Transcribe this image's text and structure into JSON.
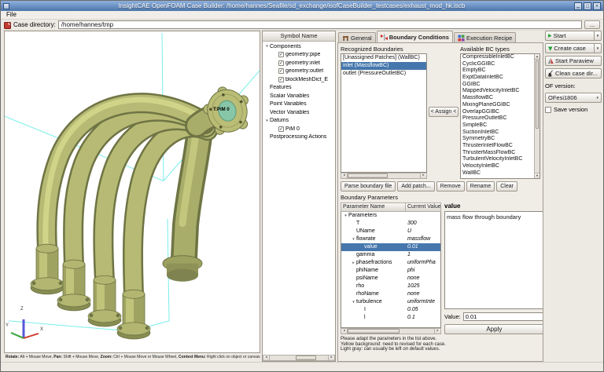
{
  "window": {
    "title": "InsightCAE OpenFOAM Case Builder: /home/hannes/Seafile/sd_exchange/isofCaseBuilder_testcases/exhaust_mod_hk.iscb",
    "menu": [
      "File"
    ]
  },
  "toolbar": {
    "case_directory_label": "Case directory:",
    "case_directory_value": "/home/hannes/tmp",
    "browse_label": "..."
  },
  "viewport": {
    "datum_label": "T:PiM 0",
    "axes": [
      "X",
      "Y",
      "Z"
    ],
    "hint_parts": [
      {
        "key": "Rotate:",
        "text": " Alt + Mouse Move, "
      },
      {
        "key": "Pan:",
        "text": " Shift + Mouse Move, "
      },
      {
        "key": "Zoom:",
        "text": " Ctrl + Mouse Move or Mouse Wheel, "
      },
      {
        "key": "Context Menu:",
        "text": " Right click on object or canvas."
      }
    ]
  },
  "symbol_tree": {
    "header": "Symbol Name",
    "items": [
      {
        "label": "Components",
        "depth": 0,
        "expander": "open"
      },
      {
        "label": "geometry:pipe",
        "depth": 1,
        "checked": true
      },
      {
        "label": "geometry:inlet",
        "depth": 1,
        "checked": true
      },
      {
        "label": "geometry:outlet",
        "depth": 1,
        "checked": true
      },
      {
        "label": "blockMeshDict_E",
        "depth": 1,
        "checked": true
      },
      {
        "label": "Features",
        "depth": 0
      },
      {
        "label": "Scalar Variables",
        "depth": 0
      },
      {
        "label": "Point Variables",
        "depth": 0
      },
      {
        "label": "Vector Variables",
        "depth": 0
      },
      {
        "label": "Datums",
        "depth": 0,
        "expander": "open"
      },
      {
        "label": "PiM 0",
        "depth": 1,
        "checked": true
      },
      {
        "label": "Postprocessing Actions",
        "depth": 0
      }
    ]
  },
  "tabs": [
    {
      "label": "General"
    },
    {
      "label": "Boundary Conditions",
      "active": true
    },
    {
      "label": "Execution Recipe"
    }
  ],
  "boundary_conditions": {
    "recognized_label": "Recognized Boundaries",
    "recognized": [
      {
        "label": "[Unassigned Patches] (WallBC)"
      },
      {
        "label": "inlet (MassflowBC)",
        "selected": true
      },
      {
        "label": "outlet (PressureOutletBC)"
      }
    ],
    "assign_label": "< Assign <",
    "available_label": "Available BC types",
    "available": [
      "CompressibleInletBC",
      "CyclicGGIBC",
      "EmptyBC",
      "ExptDataInletBC",
      "GGIBC",
      "MappedVelocityInletBC",
      "MassflowBC",
      "MixingPlaneGGIBC",
      "OverlapGGIBC",
      "PressureOutletBC",
      "SimpleBC",
      "SuctionInletBC",
      "SymmetryBC",
      "ThrusterInletFlowBC",
      "ThrusterMassFlowBC",
      "TurbulentVelocityInletBC",
      "VelocityInletBC",
      "WallBC"
    ],
    "buttons": [
      "Parse boundary file",
      "Add patch...",
      "Remove",
      "Rename",
      "Clear"
    ],
    "parameters_label": "Boundary Parameters",
    "table": {
      "columns": [
        "Parameter Name",
        "Current Value"
      ],
      "rows": [
        {
          "name": "Parameters",
          "value": "",
          "depth": 0,
          "expander": "open"
        },
        {
          "name": "T",
          "value": "300",
          "depth": 1
        },
        {
          "name": "UName",
          "value": "U",
          "depth": 1
        },
        {
          "name": "flowrate",
          "value": "massflow",
          "depth": 1,
          "expander": "open"
        },
        {
          "name": "value",
          "value": "0.01",
          "depth": 2,
          "selected": true
        },
        {
          "name": "gamma",
          "value": "1",
          "depth": 1
        },
        {
          "name": "phasefractions",
          "value": "uniformPha",
          "depth": 1,
          "expander": "closed"
        },
        {
          "name": "phiName",
          "value": "phi",
          "depth": 1
        },
        {
          "name": "psiName",
          "value": "none",
          "depth": 1
        },
        {
          "name": "rho",
          "value": "1025",
          "depth": 1
        },
        {
          "name": "rhoName",
          "value": "none",
          "depth": 1
        },
        {
          "name": "turbulence",
          "value": "uniformInte",
          "depth": 1,
          "expander": "open"
        },
        {
          "name": "I",
          "value": "0.05",
          "depth": 2
        },
        {
          "name": "l",
          "value": "0.1",
          "depth": 2
        }
      ]
    },
    "detail": {
      "title": "value",
      "description": "mass flow through boundary",
      "value_label": "Value:",
      "value": "0.01",
      "apply_label": "Apply"
    },
    "note_lines": [
      "Please adapt the parameters in the list above.",
      "Yellow background: need to revised for each case.",
      "Light gray: can usually be left on default values."
    ]
  },
  "actions": {
    "start_label": "Start",
    "create_case_label": "Create case",
    "start_paraview_label": "Start Paraview",
    "clean_case_label": "Clean case dir...",
    "of_version_label": "OF version:",
    "of_version_value": "OFesi1806",
    "save_version_label": "Save version"
  },
  "icons": {
    "play": "▶",
    "create_arrow": "▼",
    "dropdown": "▾",
    "check": "✓",
    "expander_open": "▾",
    "expander_closed": "▸",
    "scroll_left": "◂",
    "scroll_right": "▸",
    "scroll_up": "▴",
    "scroll_down": "▾",
    "minimize": "▁",
    "maximize": "□",
    "close": "✕"
  },
  "colors": {
    "selection": "#4577ad",
    "model": "#b9bd75",
    "wireframe": "#78eee9",
    "titlebar": "#5c82b5"
  }
}
